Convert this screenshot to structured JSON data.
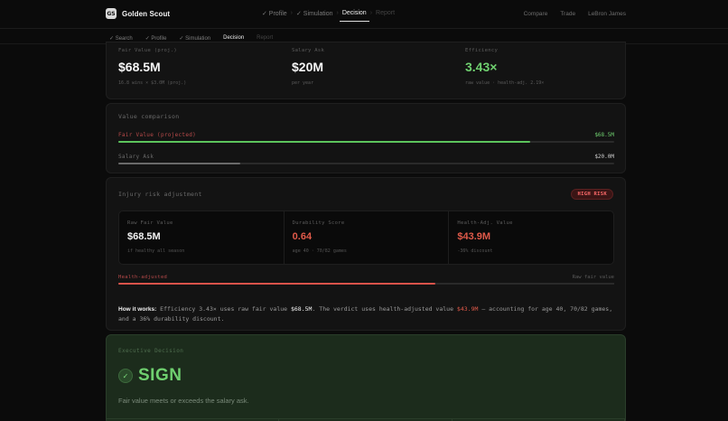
{
  "app": {
    "logo": "GS",
    "name": "Golden Scout"
  },
  "steps": [
    {
      "label": "✓ Profile",
      "state": "done"
    },
    {
      "label": "✓ Simulation",
      "state": "done"
    },
    {
      "label": "Decision",
      "state": "active"
    },
    {
      "label": "Report",
      "state": "pending"
    }
  ],
  "step_sep": "›",
  "topright": {
    "compare": "Compare",
    "trade": "Trade",
    "player": "LeBron James"
  },
  "subtabs": [
    {
      "label": "✓ Search",
      "state": "done"
    },
    {
      "label": "✓ Profile",
      "state": "done"
    },
    {
      "label": "✓ Simulation",
      "state": "done"
    },
    {
      "label": "Decision",
      "state": "active"
    },
    {
      "label": "Report",
      "state": "pending"
    }
  ],
  "metrics": [
    {
      "label": "Fair Value (proj.)",
      "value": "$68.5M",
      "sub": "16.8 wins × $3.0M (proj.)",
      "color": "white"
    },
    {
      "label": "Salary Ask",
      "value": "$20M",
      "sub": "per year",
      "color": "white"
    },
    {
      "label": "Efficiency",
      "value": "3.43×",
      "sub": "raw value · health-adj. 2.19×",
      "color": "green"
    }
  ],
  "comparison": {
    "title": "Value comparison",
    "fair": {
      "label": "Fair Value (projected)",
      "value": "$68.5M",
      "fraction": 0.83
    },
    "salary": {
      "label": "Salary Ask",
      "value": "$20.0M",
      "fraction": 0.245
    }
  },
  "injury": {
    "title": "Injury risk adjustment",
    "badge": "HIGH RISK",
    "panels": [
      {
        "label": "Raw Fair Value",
        "value": "$68.5M",
        "sub": "if healthy all season",
        "color": "white"
      },
      {
        "label": "Durability Score",
        "value": "0.64",
        "sub": "age 40 · 70/82 games",
        "color": "red"
      },
      {
        "label": "Health-Adj. Value",
        "value": "$43.9M",
        "sub": "-36% discount",
        "color": "red"
      }
    ],
    "bar": {
      "left_label": "Health-adjusted",
      "right_label": "Raw fair value",
      "fraction": 0.64
    },
    "how": {
      "lead": "How it works:",
      "t1": " Efficiency 3.43× uses raw fair value ",
      "v1": "$68.5M",
      "t2": ". The verdict uses health-adjusted value ",
      "v2": "$43.9M",
      "t3": " — accounting for age 40, 70/82 games, and a 36% durability discount."
    }
  },
  "decision": {
    "title": "Executive Decision",
    "check": "✓",
    "verdict": "SIGN",
    "sub": "Fair value meets or exceeds the salary ask."
  },
  "colors": {
    "green": "#6fd06f",
    "red": "#e05a4a",
    "gray": "#6a6a6a"
  }
}
